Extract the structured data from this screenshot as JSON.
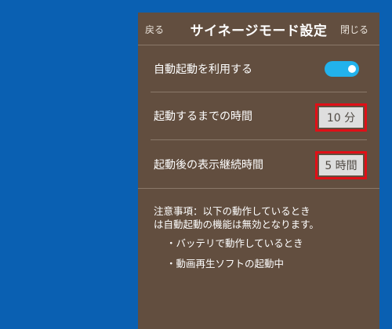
{
  "header": {
    "back_label": "戻る",
    "title": "サイネージモード設定",
    "close_label": "閉じる"
  },
  "settings": {
    "auto_start": {
      "label": "自動起動を利用する",
      "enabled": true
    },
    "time_until_start": {
      "label": "起動するまでの時間",
      "value": "10 分"
    },
    "display_duration": {
      "label": "起動後の表示継続時間",
      "value": "5 時間"
    }
  },
  "notes": {
    "line1": "注意事項：以下の動作しているとき",
    "line2": "は自動起動の機能は無効となります。",
    "bullets": [
      "・バッテリで動作しているとき",
      "・動画再生ソフトの起動中"
    ]
  },
  "colors": {
    "desktop_bg": "#0a60b2",
    "panel_bg": "#624e3f",
    "toggle_on": "#22b2ec",
    "highlight_border": "#e00f17"
  }
}
